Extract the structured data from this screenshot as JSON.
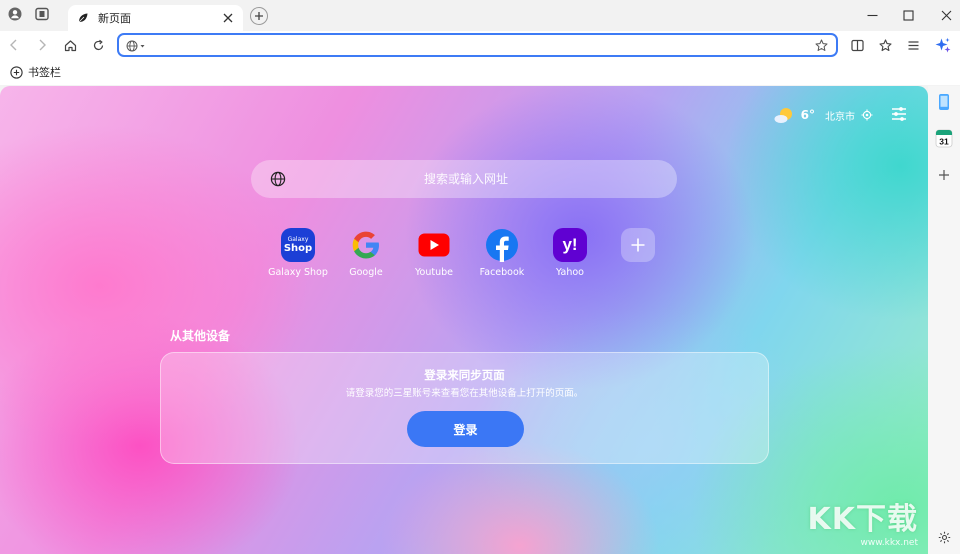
{
  "tab": {
    "title": "新页面"
  },
  "toolbar": {
    "address_value": "",
    "address_placeholder": ""
  },
  "bookmarks_bar": {
    "add_label": "书签栏"
  },
  "weather": {
    "temperature": "6°",
    "city": "北京市"
  },
  "search": {
    "placeholder": "搜索或输入网址"
  },
  "shortcuts": [
    {
      "label": "Galaxy Shop",
      "tile_text_1": "Galaxy",
      "tile_text_2": "Shop",
      "color": "#1c3fd6"
    },
    {
      "label": "Google",
      "color": "#ffffff"
    },
    {
      "label": "Youtube",
      "color": "#ff0000"
    },
    {
      "label": "Facebook",
      "color": "#1877f2"
    },
    {
      "label": "Yahoo",
      "tile_text_1": "y!",
      "color": "#6001d2"
    }
  ],
  "devices": {
    "section_title": "从其他设备",
    "card_title": "登录来同步页面",
    "card_description": "请登录您的三星账号来查看您在其他设备上打开的页面。",
    "login_label": "登录"
  },
  "side_panel": {
    "calendar_day": "31"
  },
  "watermark": {
    "logo": "KK下载",
    "url": "www.kkx.net"
  },
  "colors": {
    "accent": "#3b77f5",
    "address_border": "#3d7bf5"
  }
}
